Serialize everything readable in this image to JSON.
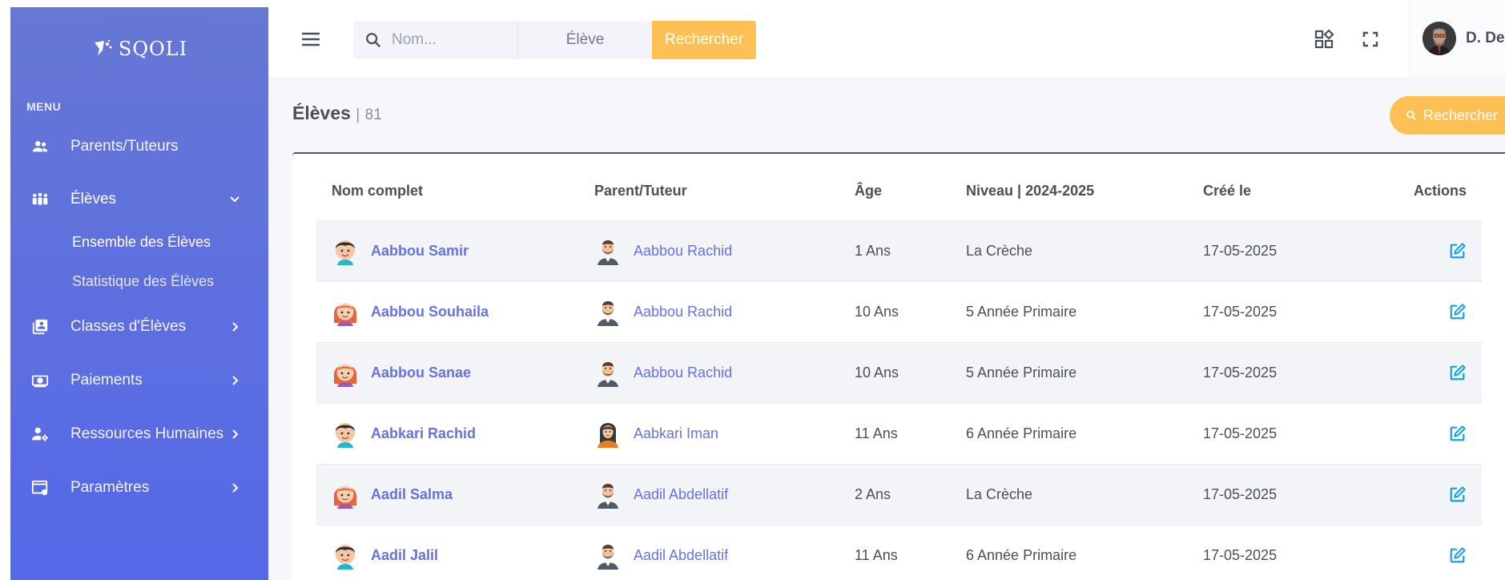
{
  "brand": {
    "logo_text": "SQOLI"
  },
  "sidebar": {
    "menu_title": "MENU",
    "items": [
      {
        "label": "Parents/Tuteurs",
        "icon": "users-icon"
      },
      {
        "label": "Élèves",
        "icon": "students-icon",
        "expanded": true,
        "subitems": [
          {
            "label": "Ensemble des Élèves",
            "active": true
          },
          {
            "label": "Statistique des Élèves"
          }
        ]
      },
      {
        "label": "Classes d'Élèves",
        "icon": "classes-icon"
      },
      {
        "label": "Paiements",
        "icon": "payment-icon"
      },
      {
        "label": "Ressources Humaines",
        "icon": "hr-icon"
      },
      {
        "label": "Paramètres",
        "icon": "settings-icon"
      }
    ]
  },
  "topbar": {
    "search": {
      "placeholder": "Nom...",
      "select_value": "Élève",
      "button_label": "Rechercher"
    },
    "user": {
      "name": "D. De"
    }
  },
  "page": {
    "title": "Élèves",
    "separator": "|",
    "count": "81",
    "search_button": "Rechercher"
  },
  "table": {
    "headers": [
      "Nom complet",
      "Parent/Tuteur",
      "Âge",
      "Niveau | 2024-2025",
      "Créé le",
      "Actions"
    ],
    "rows": [
      {
        "name": "Aabbou Samir",
        "child_avatar": "boy",
        "parent": "Aabbou Rachid",
        "parent_avatar": "man",
        "age": "1 Ans",
        "level": "La Crèche",
        "created": "17-05-2025"
      },
      {
        "name": "Aabbou Souhaila",
        "child_avatar": "girl",
        "parent": "Aabbou Rachid",
        "parent_avatar": "man",
        "age": "10 Ans",
        "level": "5 Année Primaire",
        "created": "17-05-2025"
      },
      {
        "name": "Aabbou Sanae",
        "child_avatar": "girl",
        "parent": "Aabbou Rachid",
        "parent_avatar": "man",
        "age": "10 Ans",
        "level": "5 Année Primaire",
        "created": "17-05-2025"
      },
      {
        "name": "Aabkari Rachid",
        "child_avatar": "boy",
        "parent": "Aabkari Iman",
        "parent_avatar": "woman",
        "age": "11 Ans",
        "level": "6 Année Primaire",
        "created": "17-05-2025"
      },
      {
        "name": "Aadil Salma",
        "child_avatar": "girl",
        "parent": "Aadil Abdellatif",
        "parent_avatar": "man",
        "age": "2 Ans",
        "level": "La Crèche",
        "created": "17-05-2025"
      },
      {
        "name": "Aadil Jalil",
        "child_avatar": "boy",
        "parent": "Aadil Abdellatif",
        "parent_avatar": "man",
        "age": "11 Ans",
        "level": "6 Année Primaire",
        "created": "17-05-2025"
      }
    ]
  },
  "colors": {
    "sidebar": "#5d6fe0",
    "accent": "#fcc054",
    "link": "#6672df",
    "action": "#1ba1d8"
  }
}
